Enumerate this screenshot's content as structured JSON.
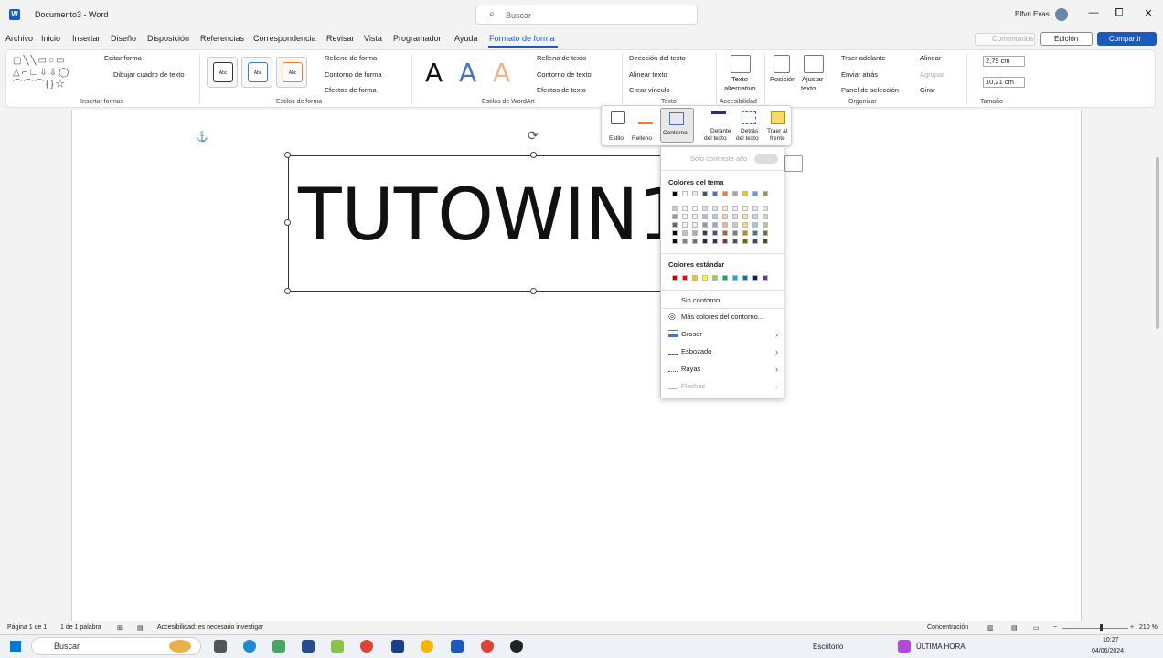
{
  "window": {
    "app_icon": "W",
    "title": "Documento3 - Word",
    "search_placeholder": "Buscar",
    "user": "Elfvrі Evas",
    "controls": [
      "—",
      "⧠",
      "✕"
    ]
  },
  "menu": [
    {
      "label": "Archivo",
      "active": false
    },
    {
      "label": "Inicio",
      "active": false
    },
    {
      "label": "Insertar",
      "active": false
    },
    {
      "label": "Diseño",
      "active": false
    },
    {
      "label": "Disposición",
      "active": false
    },
    {
      "label": "Referencias",
      "active": false
    },
    {
      "label": "Correspondencia",
      "active": false
    },
    {
      "label": "Revisar",
      "active": false
    },
    {
      "label": "Vista",
      "active": false
    },
    {
      "label": "Programador",
      "active": false
    },
    {
      "label": "Ayuda",
      "active": false
    },
    {
      "label": "Formato de forma",
      "active": true
    }
  ],
  "topright": {
    "comentarios": "Comentarios",
    "edicion": "Edición",
    "compartir": "Compartir"
  },
  "ribbon": {
    "insert_shapes": {
      "edit_shape": "Editar forma",
      "draw_textbox": "Dibujar cuadro de texto",
      "label": "Insertar formas"
    },
    "shape_styles": {
      "style_sample": "Abc",
      "fill": "Relleno de forma",
      "outline": "Contorno de forma",
      "effects": "Efectos de forma",
      "label": "Estilos de forma"
    },
    "wordart": {
      "letter": "A",
      "fill": "Relleno de texto",
      "outline": "Contorno de texto",
      "effects": "Efectos de texto",
      "label": "Estilos de WordArt"
    },
    "text": {
      "direction": "Dirección del texto",
      "align": "Alinear texto",
      "link": "Crear vínculo",
      "label": "Texto"
    },
    "accessibility": {
      "alt_text_1": "Texto",
      "alt_text_2": "alternativo",
      "label": "Accesibilidad"
    },
    "arrange": {
      "position": "Posición",
      "wrap_1": "Ajustar",
      "wrap_2": "texto",
      "bring_forward": "Traer adelante",
      "send_back": "Enviar atrás",
      "selection_pane": "Panel de selección",
      "align": "Alinear",
      "group": "Agrupar",
      "rotate": "Girar",
      "label": "Organizar"
    },
    "size": {
      "height": "2,79 cm",
      "width": "10,21 cm",
      "label": "Tamaño"
    }
  },
  "document": {
    "textbox_text": "TUTOWIN1"
  },
  "float_toolbar": {
    "estilo": "Estilo",
    "relleno": "Relleno",
    "contorno": "Contorno",
    "delante_1": "Delante",
    "delante_2": "del texto",
    "detras_1": "Detrás",
    "detras_2": "del texto",
    "traer_1": "Traer al",
    "traer_2": "frente"
  },
  "dropdown": {
    "contrast_toggle": "Solo contraste alto",
    "theme_colors": "Colores del tema",
    "standard_colors": "Colores estándar",
    "no_outline": "Sin contorno",
    "more_colors": "Más colores del contorno...",
    "weight": "Grosor",
    "sketch": "Esbozado",
    "dashes": "Rayas",
    "arrows": "Flechas",
    "theme_top": [
      "#000000",
      "#ffffff",
      "#e7e6e6",
      "#44546a",
      "#4472c4",
      "#ed7d31",
      "#a5a5a5",
      "#ffc000",
      "#5b9bd5",
      "#70ad47"
    ],
    "standard": [
      "#c00000",
      "#ff0000",
      "#ffc000",
      "#ffff00",
      "#92d050",
      "#00b050",
      "#00b0f0",
      "#0070c0",
      "#002060",
      "#7030a0"
    ]
  },
  "status": {
    "page": "Página 1 de 1",
    "words": "1 de 1 palabra",
    "accessibility": "Accesibilidad: es necesario investigar",
    "focus": "Concentración",
    "zoom": "210 %"
  },
  "taskbar": {
    "search": "Buscar",
    "desktop": "Escritorio",
    "news": "ÚLTIMA HORA",
    "time": "10:27",
    "date": "04/06/2024"
  }
}
